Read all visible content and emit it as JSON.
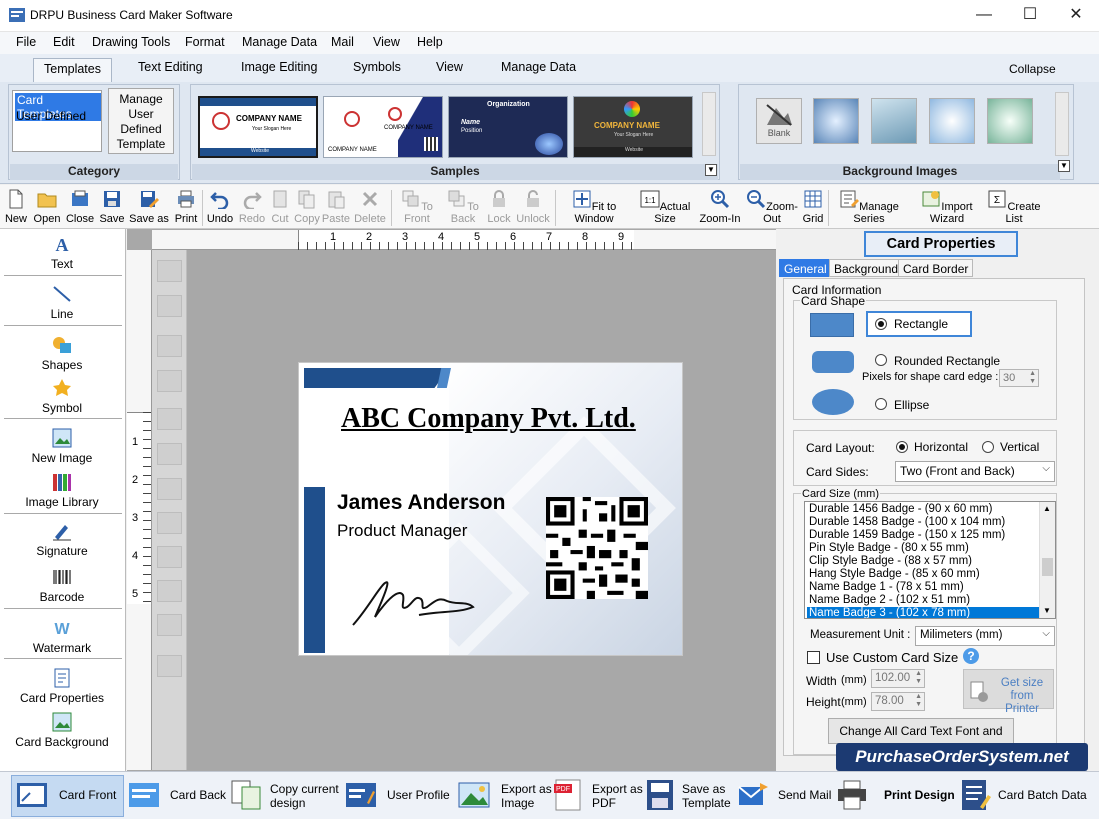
{
  "window": {
    "title": "DRPU Business Card Maker Software",
    "minimize": "—",
    "maximize": "☐",
    "close": "✕"
  },
  "menu": [
    "File",
    "Edit",
    "Drawing Tools",
    "Format",
    "Manage Data",
    "Mail",
    "View",
    "Help"
  ],
  "ribbon_tabs": [
    "Templates",
    "Text Editing",
    "Image Editing",
    "Symbols",
    "View",
    "Manage Data"
  ],
  "collapse_label": "Collapse",
  "category": {
    "title": "Category",
    "items": [
      "Card Templates",
      "User Defined"
    ],
    "manage_button": "Manage User Defined Template"
  },
  "samples": {
    "title": "Samples",
    "s1": "COMPANY NAME",
    "s1_slogan": "Your Slogan Here",
    "s1_footer": "Website",
    "s2": "COMPANY NAME",
    "s3_org": "Organization",
    "s3_name": "Name",
    "s3_pos": "Position",
    "s4": "COMPANY NAME",
    "s4_slogan": "Your Slogan Here",
    "s4_footer": "Website"
  },
  "background_images": {
    "title": "Background Images",
    "blank": "Blank"
  },
  "toolbar": {
    "new": "New",
    "open": "Open",
    "close": "Close",
    "save": "Save",
    "save_as": "Save as",
    "print": "Print",
    "undo": "Undo",
    "redo": "Redo",
    "cut": "Cut",
    "copy": "Copy",
    "paste": "Paste",
    "delete": "Delete",
    "to_front": "To Front",
    "to_back": "To Back",
    "lock": "Lock",
    "unlock": "Unlock",
    "fit_to_window": "Fit to Window",
    "actual_size": "Actual Size",
    "zoom_in": "Zoom-In",
    "zoom_out": "Zoom-Out",
    "grid": "Grid",
    "manage_series": "Manage Series",
    "import_wizard": "Import Wizard",
    "create_list": "Create List"
  },
  "left_tools": [
    "Text",
    "Line",
    "Shapes",
    "Symbol",
    "New Image",
    "Image Library",
    "Signature",
    "Barcode",
    "Watermark",
    "Card Properties",
    "Card Background"
  ],
  "ruler": {
    "h": [
      "1",
      "2",
      "3",
      "4",
      "5",
      "6",
      "7",
      "8",
      "9"
    ],
    "v": [
      "1",
      "2",
      "3",
      "4",
      "5"
    ]
  },
  "card": {
    "company": "ABC Company Pvt. Ltd.",
    "name": "James Anderson",
    "position": "Product Manager"
  },
  "card_properties": {
    "title": "Card Properties",
    "tabs": [
      "General",
      "Background",
      "Card Border"
    ],
    "card_information": "Card Information",
    "card_shape": "Card Shape",
    "shapes": [
      "Rectangle",
      "Rounded Rectangle",
      "Ellipse"
    ],
    "pixels_label": "Pixels for shape card edge :",
    "pixels_value": "30",
    "layout_label": "Card Layout:",
    "layout_options": [
      "Horizontal",
      "Vertical"
    ],
    "sides_label": "Card Sides:",
    "sides_value": "Two (Front and Back)",
    "size_label": "Card Size (mm)",
    "sizes": [
      "Durable 1456  Badge  -   (90 x 60 mm)",
      "Durable 1458  Badge  -   (100 x 104 mm)",
      "Durable 1459  Badge  -   (150 x 125 mm)",
      "Pin Style Badge  -   (80 x 55 mm)",
      "Clip Style Badge  -   (88 x 57 mm)",
      "Hang Style Badge  -   (85 x 60 mm)",
      "Name Badge 1  -   (78 x 51 mm)",
      "Name Badge 2  -   (102 x 51 mm)",
      "Name Badge 3  -   (102 x 78 mm)"
    ],
    "unit_label": "Measurement Unit :",
    "unit_value": "Milimeters (mm)",
    "custom_size": "Use Custom Card Size",
    "width_label": "Width",
    "height_label": "Height",
    "mm": "(mm)",
    "width_value": "102.00",
    "height_value": "78.00",
    "get_size": "Get size from Printer",
    "change_font": "Change All Card Text Font and Color"
  },
  "bottom": {
    "card_front": "Card Front",
    "card_back": "Card Back",
    "copy_design_1": "Copy current",
    "copy_design_2": "design",
    "user_profile": "User Profile",
    "export_image_1": "Export as",
    "export_image_2": "Image",
    "export_pdf_1": "Export as",
    "export_pdf_2": "PDF",
    "save_template_1": "Save as",
    "save_template_2": "Template",
    "send_mail": "Send Mail",
    "print_design": "Print Design",
    "batch_data": "Card Batch Data"
  },
  "watermark": "PurchaseOrderSystem.net",
  "colors": {
    "accent": "#2f7ae5",
    "card_blue": "#1f4f8c",
    "selection": "#0078d7"
  }
}
